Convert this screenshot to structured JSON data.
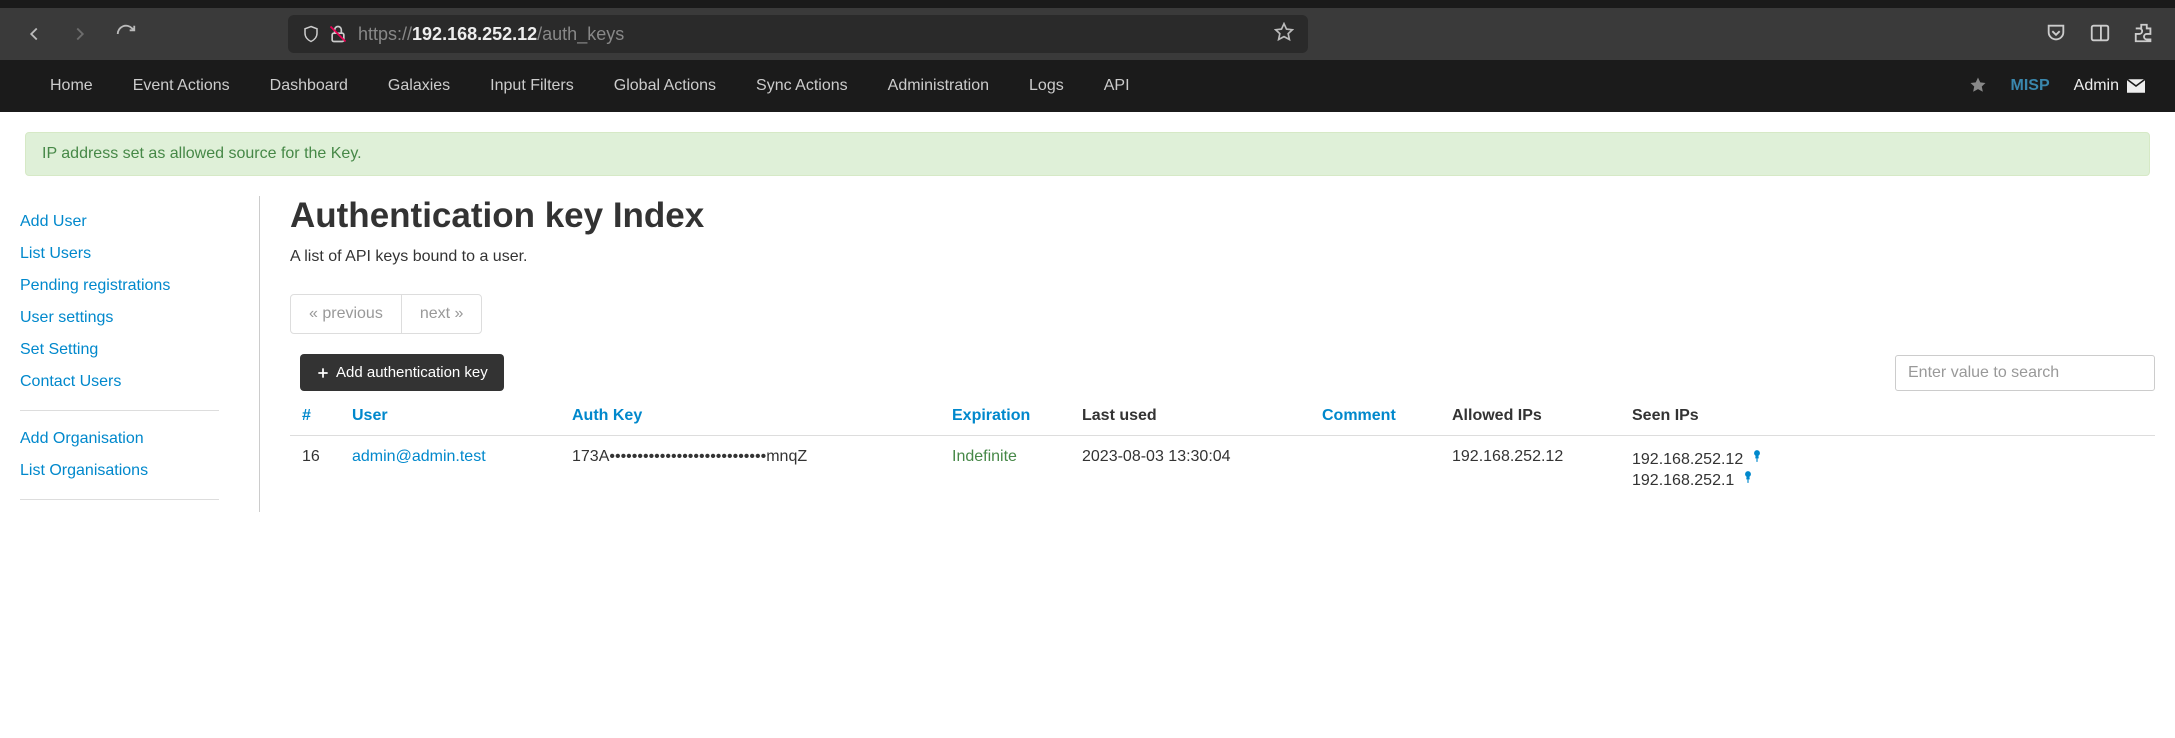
{
  "browser": {
    "url_scheme": "https://",
    "url_host": "192.168.252.12",
    "url_path": "/auth_keys"
  },
  "navbar": {
    "items": [
      "Home",
      "Event Actions",
      "Dashboard",
      "Galaxies",
      "Input Filters",
      "Global Actions",
      "Sync Actions",
      "Administration",
      "Logs",
      "API"
    ],
    "brand": "MISP",
    "user": "Admin"
  },
  "alert": {
    "message": "IP address set as allowed source for the Key."
  },
  "sidebar": {
    "group1": [
      "Add User",
      "List Users",
      "Pending registrations",
      "User settings",
      "Set Setting",
      "Contact Users"
    ],
    "group2": [
      "Add Organisation",
      "List Organisations"
    ]
  },
  "page": {
    "title": "Authentication key Index",
    "subtitle": "A list of API keys bound to a user.",
    "prev_label": "« previous",
    "next_label": "next »",
    "add_btn_label": "Add authentication key",
    "search_placeholder": "Enter value to search"
  },
  "table": {
    "headers": {
      "num": "#",
      "user": "User",
      "authkey": "Auth Key",
      "expiration": "Expiration",
      "lastused": "Last used",
      "comment": "Comment",
      "allowed": "Allowed IPs",
      "seen": "Seen IPs"
    },
    "rows": [
      {
        "num": "16",
        "user": "admin@admin.test",
        "authkey": "173A••••••••••••••••••••••••••••mnqZ",
        "expiration": "Indefinite",
        "lastused": "2023-08-03 13:30:04",
        "comment": "",
        "allowed": "192.168.252.12",
        "seen1": "192.168.252.12",
        "seen2": "192.168.252.1"
      }
    ]
  }
}
